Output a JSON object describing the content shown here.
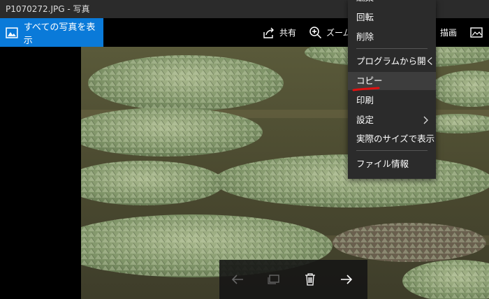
{
  "window": {
    "title": "P1070272.JPG - 写真"
  },
  "toolbar": {
    "show_all_label": "すべての写真を表示",
    "share_label": "共有",
    "zoom_label": "ズーム",
    "draw_label": "描画"
  },
  "context_menu": {
    "items": [
      {
        "label": "編集"
      },
      {
        "label": "回転"
      },
      {
        "label": "削除"
      },
      {
        "label": "プログラムから開く"
      },
      {
        "label": "コピー"
      },
      {
        "label": "印刷"
      },
      {
        "label": "設定"
      },
      {
        "label": "実際のサイズで表示"
      },
      {
        "label": "ファイル情報"
      }
    ],
    "hovered": "コピー",
    "annotation_color": "#e01010"
  },
  "photo": {
    "subject": "lily-pads-on-water"
  },
  "bottom_bar": {
    "icons": [
      "arrow-left-icon",
      "slideshow-icon",
      "trash-icon",
      "arrow-right-icon"
    ]
  },
  "colors": {
    "accent": "#0a7ad9",
    "menu_bg": "#2b2b2b"
  }
}
